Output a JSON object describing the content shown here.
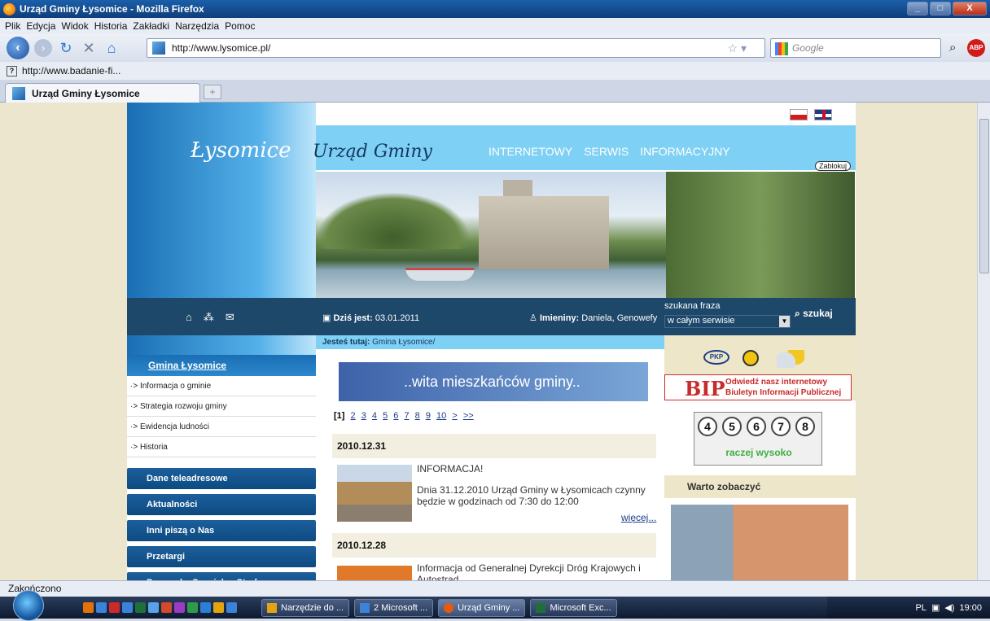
{
  "window": {
    "title": "Urząd Gminy Łysomice - Mozilla Firefox",
    "buttons": [
      "_",
      "□",
      "X"
    ]
  },
  "menubar": [
    "Plik",
    "Edycja",
    "Widok",
    "Historia",
    "Zakładki",
    "Narzędzia",
    "Pomoc"
  ],
  "navbar": {
    "url": "http://www.lysomice.pl/",
    "search_placeholder": "Google"
  },
  "bookmarks": [
    "http://www.badanie-fi..."
  ],
  "tabs": [
    {
      "label": "Urząd Gminy Łysomice",
      "active": true
    }
  ],
  "statusbar": "Zakończono",
  "taskbar": {
    "buttons": [
      "Narzędzie do ...",
      "2 Microsoft ...",
      "Urząd Gminy ...",
      "Microsoft Exc..."
    ],
    "tray": {
      "lang": "PL",
      "time": "19:00"
    }
  },
  "site": {
    "logo": "Łysomice",
    "subtitle": "Urząd Gminy",
    "nav": [
      "INTERNETOWY",
      "SERWIS",
      "INFORMACYJNY"
    ],
    "zablokuj": "Zablokuj",
    "date_label": "Dziś jest:",
    "date_value": "03.01.2011",
    "names_label": "Imieniny:",
    "names_value": "Daniela, Genowefy",
    "search": {
      "phrase": "szukana fraza",
      "scope": "w całym serwisie",
      "button": "szukaj"
    },
    "breadcrumb_label": "Jesteś tutaj:",
    "breadcrumb_value": "Gmina Łysomice/",
    "left_nav": {
      "header": "Gmina Łysomice",
      "sub_items": [
        "Informacja o gminie",
        "Strategia rozwoju gminy",
        "Ewidencja ludności",
        "Historia"
      ],
      "buttons": [
        "Dane teleadresowe",
        "Aktualności",
        "Inni piszą o Nas",
        "Przetargi",
        "Pomorska Specjalna Strefa"
      ]
    },
    "welcome": "..wita mieszkańców gminy..",
    "pager": {
      "current": "[1]",
      "pages": [
        "2",
        "3",
        "4",
        "5",
        "6",
        "7",
        "8",
        "9",
        "10",
        ">",
        ">>"
      ]
    },
    "news": [
      {
        "date": "2010.12.31",
        "title": "INFORMACJA!",
        "text": "Dnia 31.12.2010 Urząd Gminy w Łysomicach czynny będzie w godzinach od 7:30 do 12:00",
        "more": "więcej..."
      },
      {
        "date": "2010.12.28",
        "text": "Informacja od Generalnej Dyrekcji Dróg Krajowych i Autostrad"
      }
    ],
    "right": {
      "pkp": "PKP",
      "bip_logo": "BIP",
      "bip_text_1": "Odwiedź nasz internetowy",
      "bip_text_2": "Biuletyn Informacji Publicznej",
      "pollen_numbers": [
        "4",
        "5",
        "6",
        "7",
        "8"
      ],
      "pollen_label": "raczej wysoko",
      "warto": "Warto zobaczyć"
    }
  }
}
